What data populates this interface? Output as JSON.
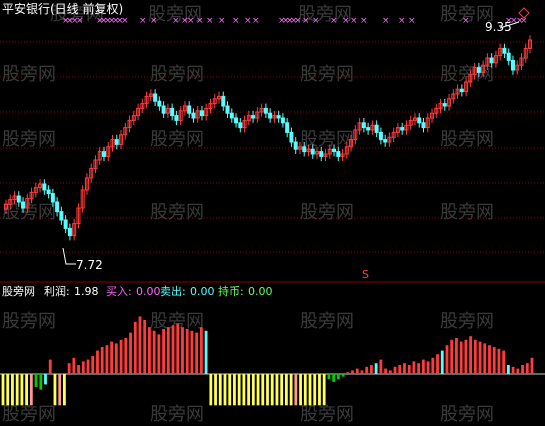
{
  "title": "平安银行(日线 前复权)",
  "watermark": "股旁网",
  "price_high_label": "9.35",
  "price_low_label": "7.72",
  "s_marker": "S",
  "indicator": {
    "name": "股旁网",
    "profit_label": "利润:",
    "profit_value": "1.98",
    "buy_label": "买入:",
    "buy_value": "0.00",
    "sell_label": "卖出:",
    "sell_value": "0.00",
    "hold_label": "持币:",
    "hold_value": "0.00"
  },
  "colors": {
    "background": "#000000",
    "up": "#ff3c3c",
    "down": "#54ffff",
    "grid": "#8b0000",
    "buy": "#ff66ff",
    "sell": "#54ffff",
    "hold": "#66ff66",
    "yellow": "#ffff55",
    "green": "#00cc00",
    "pink": "#ff9999"
  },
  "chart_data": {
    "type": "candlestick",
    "ylim": [
      7.6,
      9.45
    ],
    "closes": [
      7.98,
      8.02,
      8.05,
      8.0,
      7.95,
      8.03,
      8.08,
      8.12,
      8.15,
      8.1,
      8.07,
      8.0,
      7.92,
      7.85,
      7.78,
      7.72,
      7.82,
      7.95,
      8.1,
      8.2,
      8.28,
      8.35,
      8.42,
      8.38,
      8.46,
      8.52,
      8.48,
      8.56,
      8.62,
      8.68,
      8.72,
      8.78,
      8.82,
      8.88,
      8.9,
      8.84,
      8.8,
      8.74,
      8.78,
      8.72,
      8.68,
      8.76,
      8.8,
      8.74,
      8.7,
      8.76,
      8.72,
      8.78,
      8.82,
      8.86,
      8.88,
      8.8,
      8.74,
      8.7,
      8.66,
      8.62,
      8.68,
      8.72,
      8.7,
      8.75,
      8.78,
      8.74,
      8.7,
      8.72,
      8.7,
      8.66,
      8.58,
      8.5,
      8.44,
      8.46,
      8.42,
      8.44,
      8.4,
      8.42,
      8.38,
      8.4,
      8.44,
      8.42,
      8.38,
      8.4,
      8.46,
      8.52,
      8.6,
      8.66,
      8.62,
      8.6,
      8.64,
      8.58,
      8.52,
      8.5,
      8.54,
      8.58,
      8.62,
      8.6,
      8.64,
      8.68,
      8.7,
      8.66,
      8.62,
      8.7,
      8.74,
      8.78,
      8.82,
      8.8,
      8.86,
      8.9,
      8.94,
      8.92,
      9.0,
      9.06,
      9.12,
      9.08,
      9.14,
      9.2,
      9.16,
      9.22,
      9.28,
      9.24,
      9.18,
      9.1,
      9.14,
      9.2,
      9.28,
      9.35
    ],
    "indicator_values": [
      -1.2,
      -1.2,
      -1.2,
      -1.2,
      -1.2,
      -1.2,
      -1.2,
      -0.5,
      -0.6,
      -0.4,
      0.8,
      -1.2,
      -1.2,
      -1.2,
      0.6,
      0.9,
      0.5,
      0.7,
      0.8,
      1.0,
      1.3,
      1.5,
      1.6,
      1.8,
      1.7,
      1.9,
      2.0,
      2.3,
      2.9,
      3.2,
      3.0,
      2.6,
      2.4,
      2.2,
      2.5,
      2.6,
      2.7,
      2.8,
      2.6,
      2.5,
      2.4,
      2.3,
      2.6,
      2.4,
      -1.2,
      -1.2,
      -1.2,
      -1.2,
      -1.2,
      -1.2,
      -1.2,
      -1.2,
      -1.2,
      -1.2,
      -1.2,
      -1.2,
      -1.2,
      -1.2,
      -1.2,
      -1.2,
      -1.2,
      -1.2,
      -1.2,
      -1.2,
      -1.2,
      -1.2,
      -1.2,
      -1.2,
      -1.2,
      -0.2,
      -0.3,
      -0.2,
      -0.1,
      0.1,
      0.2,
      0.3,
      0.2,
      0.4,
      0.5,
      0.6,
      0.8,
      0.3,
      0.2,
      0.4,
      0.5,
      0.6,
      0.5,
      0.7,
      0.6,
      0.8,
      0.7,
      0.9,
      1.1,
      1.3,
      1.6,
      1.9,
      2.0,
      1.8,
      1.9,
      2.1,
      1.9,
      1.8,
      1.7,
      1.6,
      1.5,
      1.4,
      1.3,
      0.5,
      0.4,
      0.3,
      0.5,
      0.6,
      0.9
    ],
    "title": "平安银行(日线 前复权)"
  }
}
